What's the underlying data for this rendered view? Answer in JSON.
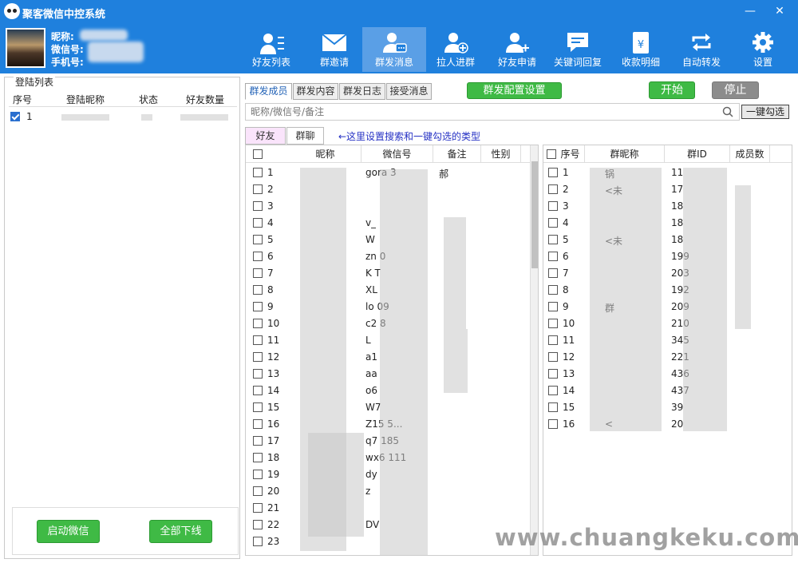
{
  "window": {
    "title": "聚客微信中控系统",
    "min_glyph": "—",
    "close_glyph": "✕"
  },
  "user": {
    "nickname_label": "昵称:",
    "wechat_label": "微信号:",
    "phone_label": "手机号:"
  },
  "toolbar": [
    {
      "label": "好友列表",
      "icon": "contacts-icon"
    },
    {
      "label": "群邀请",
      "icon": "envelope-icon"
    },
    {
      "label": "群发消息",
      "icon": "users-message-icon",
      "active": true
    },
    {
      "label": "拉人进群",
      "icon": "add-member-icon"
    },
    {
      "label": "好友申请",
      "icon": "friend-request-icon"
    },
    {
      "label": "关键词回复",
      "icon": "chat-bubble-icon"
    },
    {
      "label": "收款明细",
      "icon": "money-envelope-icon"
    },
    {
      "label": "自动转发",
      "icon": "repeat-icon"
    },
    {
      "label": "设置",
      "icon": "gear-icon"
    }
  ],
  "login_panel": {
    "title": "登陆列表",
    "columns": [
      "序号",
      "登陆昵称",
      "状态",
      "好友数量"
    ],
    "rows": [
      {
        "index": "1",
        "checked": true
      }
    ],
    "start_button": "启动微信",
    "offline_button": "全部下线"
  },
  "main": {
    "tabs": [
      "群发成员",
      "群发内容",
      "群发日志",
      "接受消息"
    ],
    "active_tab": "群发成员",
    "config_button": "群发配置设置",
    "start_button": "开始",
    "stop_button": "停止",
    "search_placeholder": "昵称/微信号/备注",
    "one_click_button": "一键勾选",
    "sub_tabs": [
      "好友",
      "群聊"
    ],
    "hint": "←这里设置搜索和一键勾选的类型"
  },
  "friends_table": {
    "columns": [
      "昵称",
      "微信号",
      "备注",
      "性别"
    ],
    "rows": [
      {
        "index": "1",
        "wechat": "gora   3",
        "remark": "郝"
      },
      {
        "index": "2",
        "wechat": "",
        "remark": ""
      },
      {
        "index": "3",
        "wechat": "",
        "remark": ""
      },
      {
        "index": "4",
        "wechat": "v_",
        "remark": ""
      },
      {
        "index": "5",
        "wechat": "W",
        "remark": ""
      },
      {
        "index": "6",
        "wechat": "zn          0",
        "remark": ""
      },
      {
        "index": "7",
        "wechat": "K           T",
        "remark": ""
      },
      {
        "index": "8",
        "wechat": "XL",
        "remark": ""
      },
      {
        "index": "9",
        "wechat": "lo         09",
        "remark": ""
      },
      {
        "index": "10",
        "wechat": "c2          8",
        "remark": ""
      },
      {
        "index": "11",
        "wechat": "L",
        "remark": ""
      },
      {
        "index": "12",
        "wechat": "a1",
        "remark": ""
      },
      {
        "index": "13",
        "wechat": "aa",
        "remark": ""
      },
      {
        "index": "14",
        "wechat": "o6",
        "remark": ""
      },
      {
        "index": "15",
        "wechat": "W7",
        "remark": ""
      },
      {
        "index": "16",
        "wechat": "Z15        5...",
        "remark": ""
      },
      {
        "index": "17",
        "wechat": "q7         185",
        "remark": ""
      },
      {
        "index": "18",
        "wechat": "wx6        111",
        "remark": ""
      },
      {
        "index": "19",
        "wechat": "dy",
        "remark": ""
      },
      {
        "index": "20",
        "wechat": "z",
        "remark": ""
      },
      {
        "index": "21",
        "wechat": "",
        "remark": ""
      },
      {
        "index": "22",
        "wechat": "DV",
        "remark": ""
      },
      {
        "index": "23",
        "wechat": "",
        "remark": ""
      }
    ]
  },
  "groups_table": {
    "columns": [
      "序号",
      "群昵称",
      "群ID",
      "成员数"
    ],
    "rows": [
      {
        "index": "1",
        "name": "锅",
        "gid": "11"
      },
      {
        "index": "2",
        "name": "<未",
        "gid": "17"
      },
      {
        "index": "3",
        "name": "",
        "gid": "18"
      },
      {
        "index": "4",
        "name": "",
        "gid": "18"
      },
      {
        "index": "5",
        "name": "<未",
        "gid": "18"
      },
      {
        "index": "6",
        "name": "",
        "gid": "199"
      },
      {
        "index": "7",
        "name": "",
        "gid": "203"
      },
      {
        "index": "8",
        "name": "",
        "gid": "192"
      },
      {
        "index": "9",
        "name": "群",
        "gid": "209"
      },
      {
        "index": "10",
        "name": "",
        "gid": "210"
      },
      {
        "index": "11",
        "name": "",
        "gid": "345"
      },
      {
        "index": "12",
        "name": "",
        "gid": "221"
      },
      {
        "index": "13",
        "name": "",
        "gid": "436"
      },
      {
        "index": "14",
        "name": "",
        "gid": "437"
      },
      {
        "index": "15",
        "name": "",
        "gid": "39"
      },
      {
        "index": "16",
        "name": "<",
        "gid": "20"
      }
    ]
  },
  "watermark": "www.chuangkeku.com",
  "colors": {
    "header": "#1f80dd",
    "active_tool": "#5a9fe6",
    "green": "#3fba45",
    "stop": "#8c8c8c",
    "hint": "#2430c4"
  }
}
